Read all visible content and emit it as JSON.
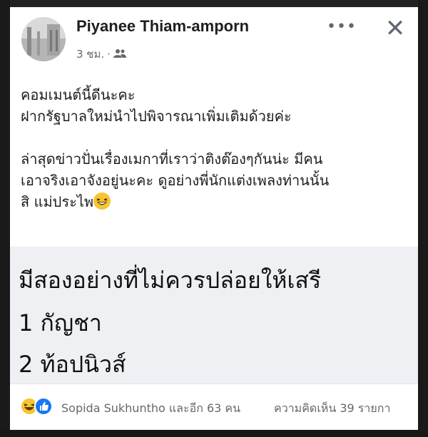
{
  "post": {
    "author": "Piyanee Thiam-amporn",
    "time": "3 ชม.",
    "audience_icon": "friends-icon",
    "more_icon": "more-options-icon",
    "close_icon": "close-icon",
    "body": {
      "line1": "คอมเมนต์นี้ดีนะคะ",
      "line2": "ฝากรัฐบาลใหม่นำไปพิจารณาเพิ่มเติมด้วยค่ะ",
      "line3": "ล่าสุดข่าวปั่นเรื่องเมกาที่เราว่าติงต๊องๆกันน่ะ มีคน",
      "line4": "เอาจริงเอาจังอยู่นะคะ ดูอย่างพี่นักแต่งเพลงท่านนั้น",
      "line5": "สิ แม่ประไพ"
    },
    "big_text": {
      "line1": "มีสองอย่างที่ไม่ควรปล่อยให้เสรี",
      "line2": "1 กัญชา",
      "line3": "2 ท้อปนิวส์"
    },
    "reactions": {
      "icons": [
        "haha-icon",
        "like-icon"
      ],
      "summary": "Sopida Sukhuntho และอีก 63 คน",
      "comments": "ความคิดเห็น 39 รายกา"
    }
  },
  "colors": {
    "text_primary": "#1c1e21",
    "text_secondary": "#65676b",
    "like_blue": "#1877f2",
    "haha_yellow": "#f7c531",
    "big_block_bg": "#eef0f4"
  }
}
